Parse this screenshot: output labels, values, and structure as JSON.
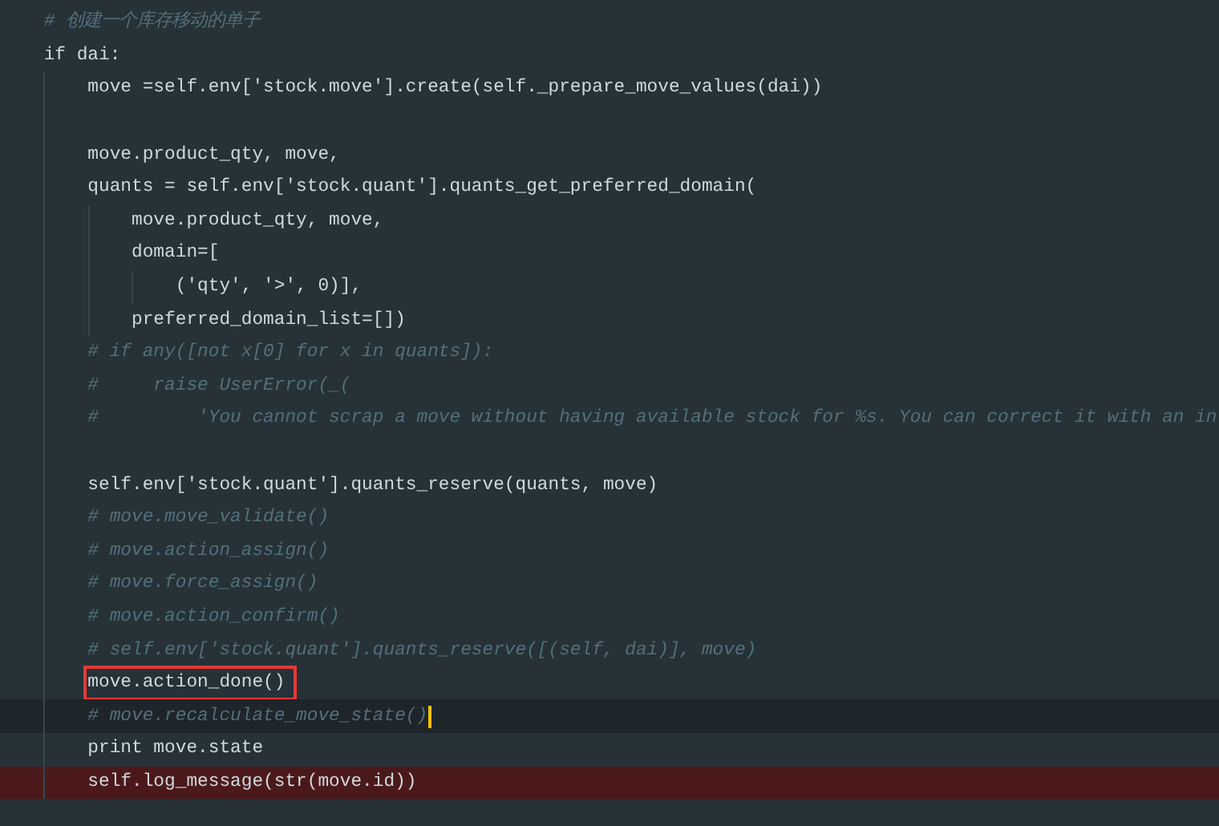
{
  "editor": {
    "lines": [
      {
        "kind": "comment",
        "text": "# 创建一个库存移动的单子"
      },
      {
        "kind": "code",
        "text": "if dai:",
        "children": [
          {
            "kind": "code",
            "text": "move =self.env['stock.move'].create(self._prepare_move_values(dai))"
          },
          {
            "kind": "blank"
          },
          {
            "kind": "code",
            "text": "move.product_qty, move,"
          },
          {
            "kind": "code",
            "text": "quants = self.env['stock.quant'].quants_get_preferred_domain(",
            "children": [
              {
                "kind": "code",
                "text": "move.product_qty, move,"
              },
              {
                "kind": "code",
                "text": "domain=[",
                "children": [
                  {
                    "kind": "code",
                    "text": "('qty', '>', 0)],"
                  }
                ]
              },
              {
                "kind": "code",
                "text": "preferred_domain_list=[])"
              }
            ]
          },
          {
            "kind": "comment",
            "text": "# if any([not x[0] for x in quants]):"
          },
          {
            "kind": "comment",
            "text": "#     raise UserError(_("
          },
          {
            "kind": "comment",
            "text": "#         'You cannot scrap a move without having available stock for %s. You can correct it with an in"
          },
          {
            "kind": "blank"
          },
          {
            "kind": "code",
            "text": "self.env['stock.quant'].quants_reserve(quants, move)"
          },
          {
            "kind": "comment",
            "text": "# move.move_validate()"
          },
          {
            "kind": "comment",
            "text": "# move.action_assign()"
          },
          {
            "kind": "comment",
            "text": "# move.force_assign()"
          },
          {
            "kind": "comment",
            "text": "# move.action_confirm()"
          },
          {
            "kind": "comment",
            "text": "# self.env['stock.quant'].quants_reserve([(self, dai)], move)"
          },
          {
            "kind": "code",
            "text": "move.action_done()",
            "boxed": true
          },
          {
            "kind": "comment",
            "text": "# move.recalculate_move_state()",
            "current_line": true,
            "cursor": true
          },
          {
            "kind": "code",
            "text": "print move.state"
          },
          {
            "kind": "code",
            "text": "self.log_message(str(move.id))",
            "error_line": true
          }
        ]
      }
    ]
  }
}
